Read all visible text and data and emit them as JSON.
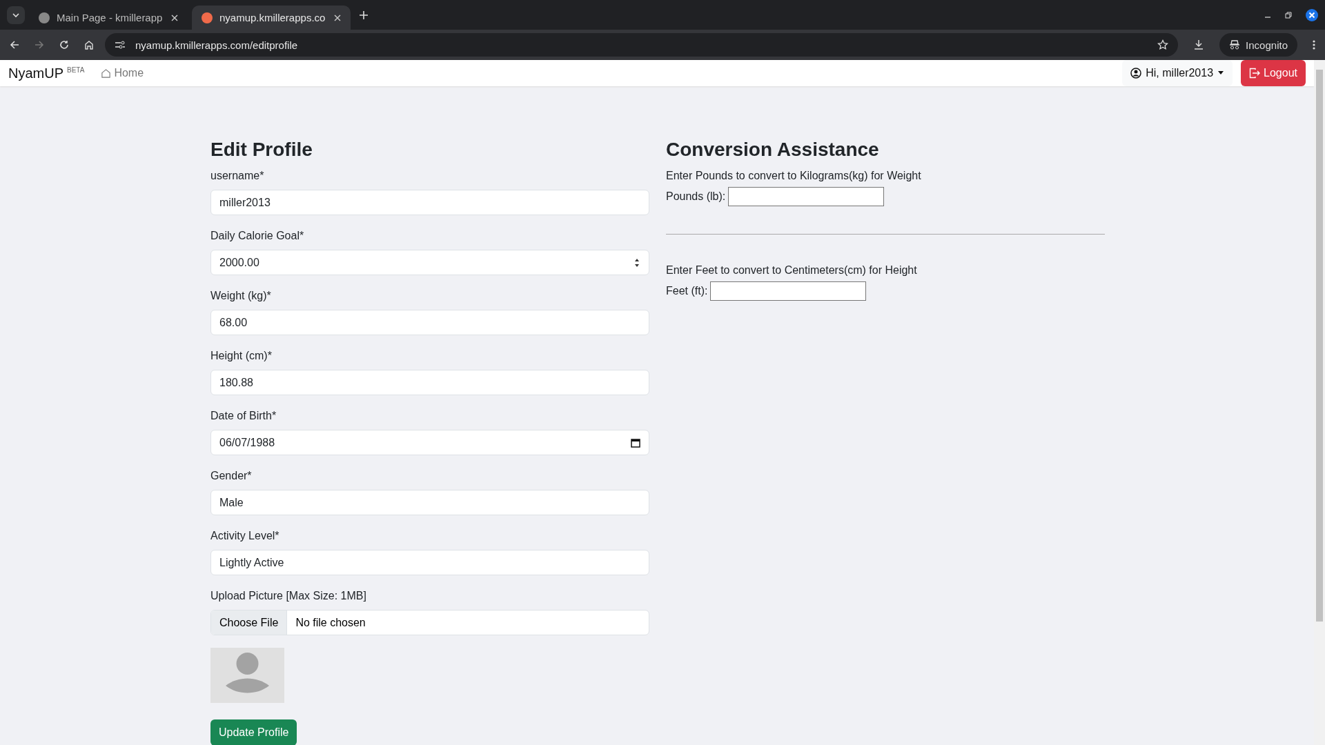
{
  "browser": {
    "tabs": [
      {
        "title": "Main Page - kmillerapp",
        "selected": false
      },
      {
        "title": "nyamup.kmillerapps.co",
        "selected": true
      }
    ],
    "url": "nyamup.kmillerapps.com/editprofile",
    "profile": "Incognito"
  },
  "navbar": {
    "brand": "NyamUP",
    "badge": "BETA",
    "home": "Home",
    "user_menu": "Hi, miller2013",
    "logout": "Logout"
  },
  "edit_profile": {
    "title": "Edit Profile",
    "fields": [
      {
        "label": "username*",
        "value": "miller2013",
        "kind": "text"
      },
      {
        "label": "Daily Calorie Goal*",
        "value": "2000.00",
        "kind": "number"
      },
      {
        "label": "Weight (kg)*",
        "value": "68.00",
        "kind": "text"
      },
      {
        "label": "Height (cm)*",
        "value": "180.88",
        "kind": "text"
      },
      {
        "label": "Date of Birth*",
        "value": "06/07/1988",
        "kind": "date"
      },
      {
        "label": "Gender*",
        "value": "Male",
        "kind": "text"
      },
      {
        "label": "Activity Level*",
        "value": "Lightly Active",
        "kind": "text"
      }
    ],
    "upload": {
      "label": "Upload Picture [Max Size: 1MB]",
      "button": "Choose File",
      "status": "No file chosen"
    },
    "submit": "Update Profile"
  },
  "conversion": {
    "title": "Conversion Assistance",
    "sections": [
      {
        "instruction": "Enter Pounds to convert to Kilograms(kg) for Weight",
        "label": "Pounds (lb):"
      },
      {
        "instruction": "Enter Feet to convert to Centimeters(cm) for Height",
        "label": "Feet (ft):"
      }
    ]
  }
}
